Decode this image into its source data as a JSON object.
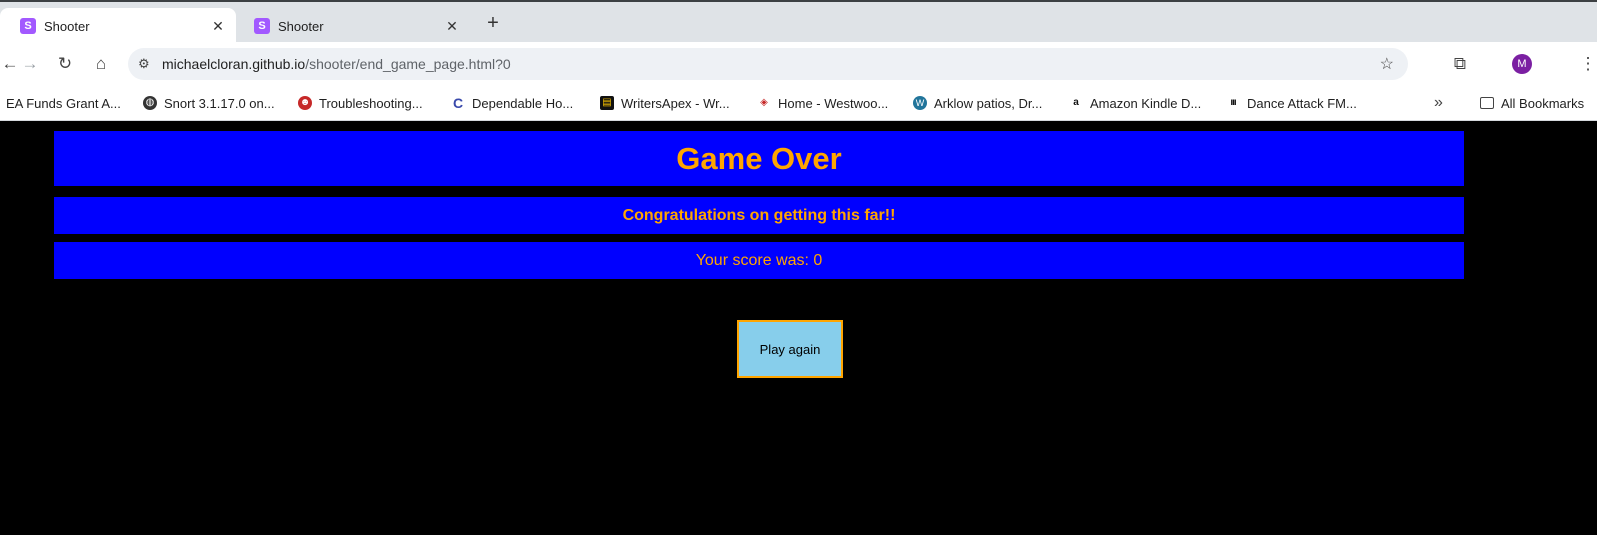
{
  "browser": {
    "tabs": [
      {
        "title": "Shooter",
        "favicon_letter": "S",
        "active": true
      },
      {
        "title": "Shooter",
        "favicon_letter": "S",
        "active": false
      }
    ],
    "new_tab_label": "+",
    "close_glyph": "✕",
    "url_host": "michaelcloran.github.io",
    "url_path": "/shooter/end_game_page.html?0",
    "profile_initial": "M",
    "bookmarks": [
      {
        "label": "EA Funds Grant A...",
        "icon": "none"
      },
      {
        "label": "Snort 3.1.17.0 on...",
        "icon": "globe-icon"
      },
      {
        "label": "Troubleshooting...",
        "icon": "devil-icon"
      },
      {
        "label": "Dependable Ho...",
        "icon": "c-logo-icon"
      },
      {
        "label": "WritersApex - Wr...",
        "icon": "book-icon"
      },
      {
        "label": "Home - Westwoo...",
        "icon": "box-icon"
      },
      {
        "label": "Arklow patios, Dr...",
        "icon": "wordpress-icon"
      },
      {
        "label": "Amazon Kindle D...",
        "icon": "amazon-icon"
      },
      {
        "label": "Dance Attack FM...",
        "icon": "bars-icon"
      }
    ],
    "overflow_glyph": "»",
    "all_bookmarks_label": "All Bookmarks"
  },
  "game": {
    "title": "Game Over",
    "congrats": "Congratulations on getting this far!!",
    "score_text": "Your score was: 0",
    "play_again_label": "Play again"
  },
  "colors": {
    "page_bg": "#000000",
    "banner_bg": "#0000ff",
    "banner_text": "#ffa500",
    "button_bg": "#87ceeb",
    "button_border": "#ffa500"
  }
}
